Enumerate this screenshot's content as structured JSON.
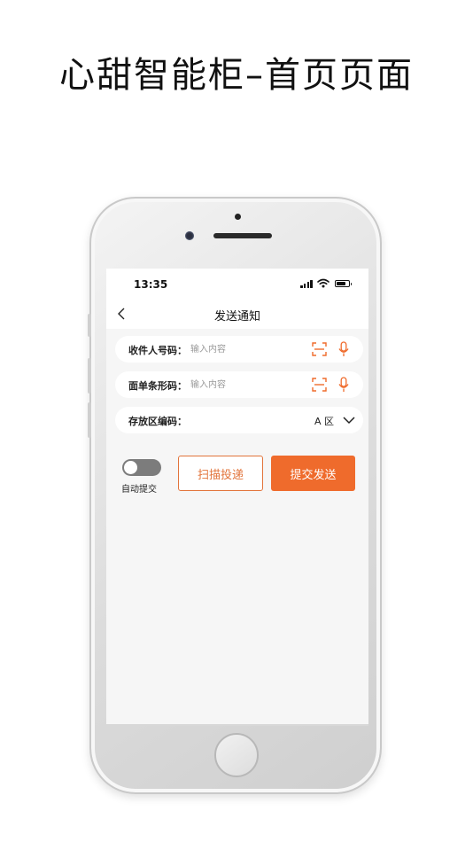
{
  "headline": "心甜智能柜–首页页面",
  "status_bar": {
    "time": "13:35"
  },
  "navbar": {
    "title": "发送通知",
    "back_icon": "chevron-left-icon"
  },
  "form": {
    "recipient": {
      "label": "收件人号码：",
      "placeholder": "输入内容",
      "value": ""
    },
    "waybill": {
      "label": "面单条形码：",
      "placeholder": "输入内容",
      "value": ""
    },
    "storage_area": {
      "label": "存放区编码：",
      "selected": "A 区"
    }
  },
  "auto_submit": {
    "label": "自动提交",
    "enabled": false
  },
  "buttons": {
    "scan_deliver": "扫描投递",
    "submit_send": "提交发送"
  },
  "colors": {
    "accent": "#ef6b2c",
    "accent_outline": "#e2743b",
    "background": "#f6f6f6",
    "toggle_off": "#7c7c7c"
  }
}
